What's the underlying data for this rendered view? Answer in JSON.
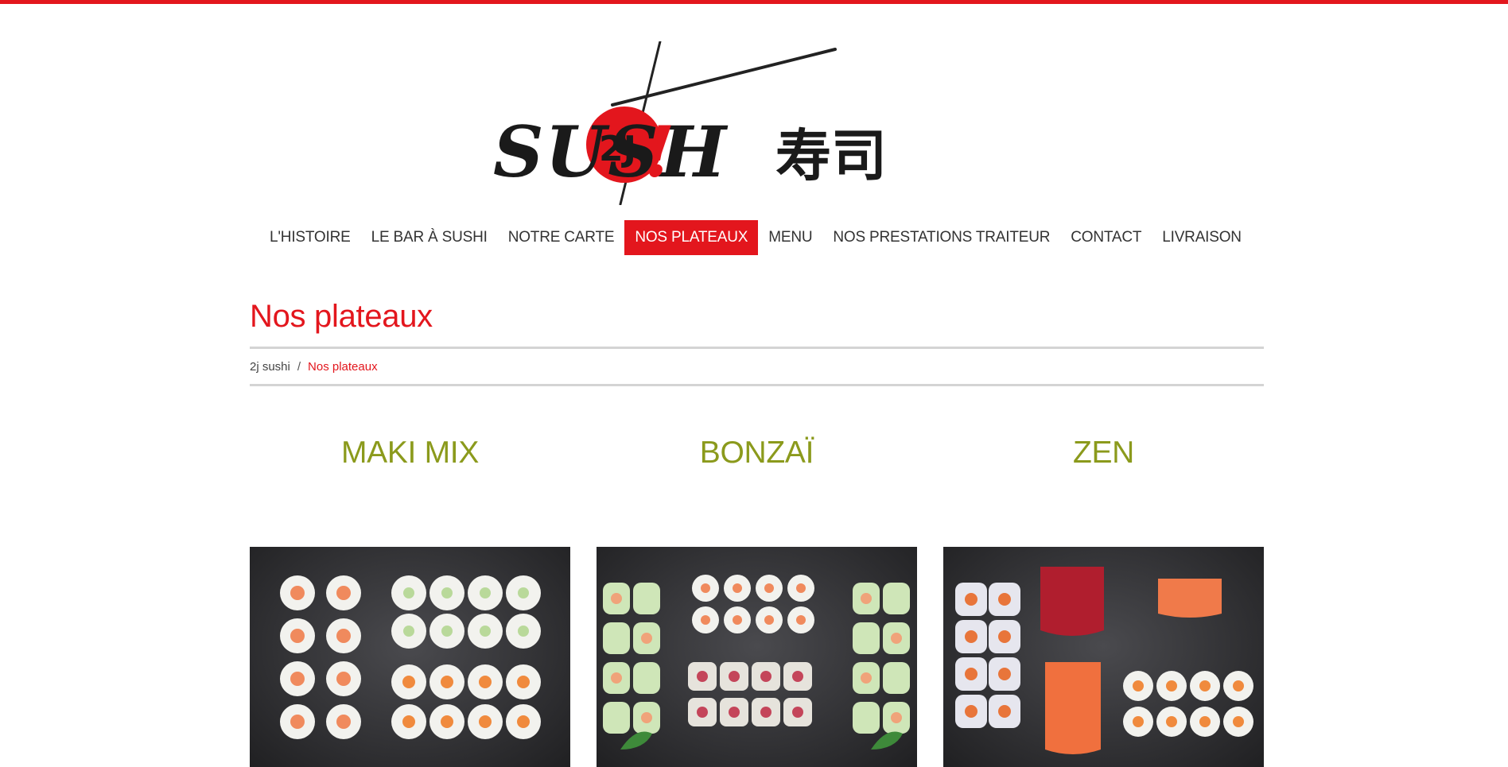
{
  "brand": {
    "logo_text": "SUSHI",
    "logo_badge": "2J",
    "logo_kanji": "寿司",
    "accent_color": "#e3161d",
    "title_color": "#8b9a1c"
  },
  "nav": {
    "items": [
      {
        "label": "L'HISTOIRE",
        "active": false
      },
      {
        "label": "LE BAR À SUSHI",
        "active": false
      },
      {
        "label": "NOTRE CARTE",
        "active": false
      },
      {
        "label": "NOS PLATEAUX",
        "active": true
      },
      {
        "label": "MENU",
        "active": false
      },
      {
        "label": "NOS PRESTATIONS TRAITEUR",
        "active": false
      },
      {
        "label": "CONTACT",
        "active": false
      },
      {
        "label": "LIVRAISON",
        "active": false
      }
    ]
  },
  "page": {
    "title": "Nos plateaux"
  },
  "breadcrumb": {
    "home": "2j sushi",
    "separator": "/",
    "current": "Nos plateaux"
  },
  "products": [
    {
      "name": "MAKI MIX",
      "image": "sushi-platter-photo"
    },
    {
      "name": "BONZAÏ",
      "image": "sushi-platter-photo"
    },
    {
      "name": "ZEN",
      "image": "sushi-platter-photo"
    }
  ]
}
